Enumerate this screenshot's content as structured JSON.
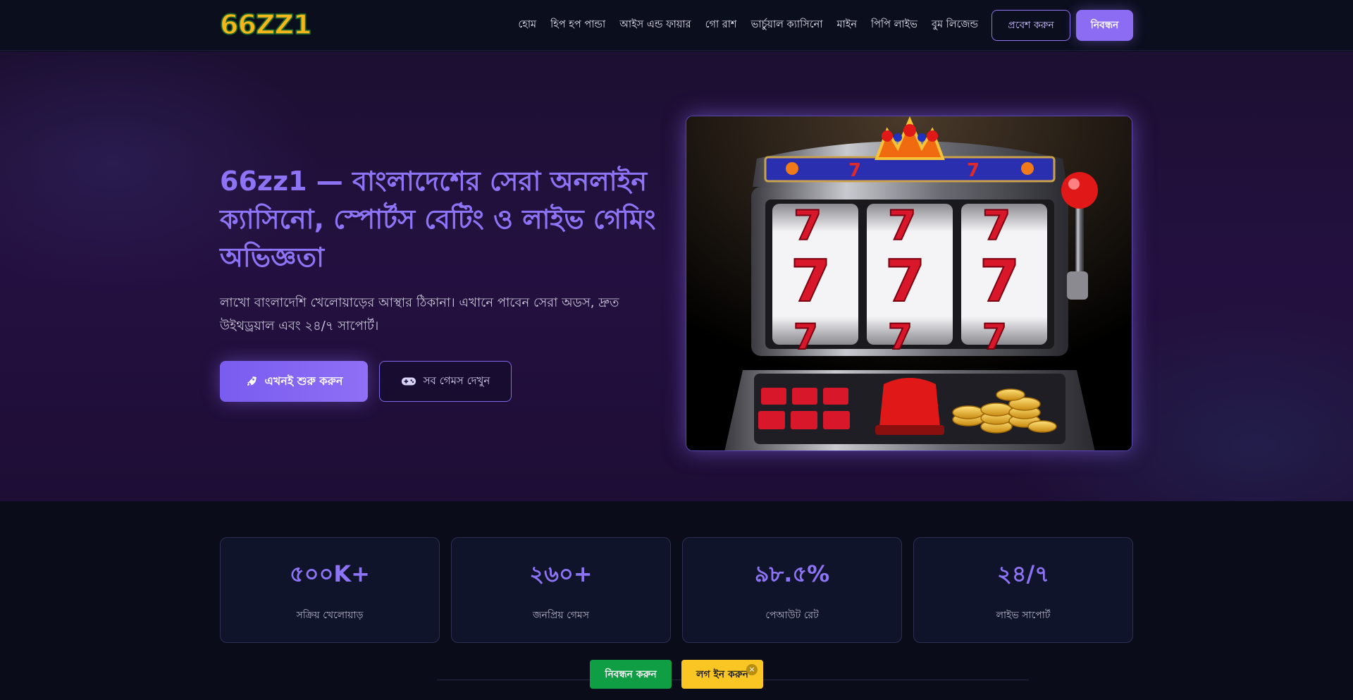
{
  "brand": {
    "logo_text": "66ZZ1"
  },
  "nav": {
    "items": [
      "হোম",
      "হিপ হপ পান্ডা",
      "আইস এন্ড ফায়ার",
      "গো রাশ",
      "ভার্চুয়াল ক্যাসিনো",
      "মাইন",
      "পিপি লাইভ",
      "বুম লিজেন্ড"
    ],
    "login_label": "প্রবেশ করুন",
    "register_label": "নিবন্ধন"
  },
  "hero": {
    "title": "66zz1 — বাংলাদেশের সেরা অনলাইন ক্যাসিনো, স্পোর্টস বেটিং ও লাইভ গেমিং অভিজ্ঞতা",
    "subtitle": "লাখো বাংলাদেশি খেলোয়াড়ের আস্থার ঠিকানা। এখানে পাবেন সেরা অডস, দ্রুত উইথড্রয়াল এবং ২৪/৭ সাপোর্ট।",
    "primary_button": "এখনই শুরু করুন",
    "primary_icon": "rocket-icon",
    "secondary_button": "সব গেমস দেখুন",
    "secondary_icon": "gamepad-icon",
    "image_name": "slot-machine-image"
  },
  "stats": [
    {
      "value": "৫০০K+",
      "label": "সক্রিয় খেলোয়াড়"
    },
    {
      "value": "২৬০+",
      "label": "জনপ্রিয় গেমস"
    },
    {
      "value": "৯৮.৫%",
      "label": "পেআউট রেট"
    },
    {
      "value": "২৪/৭",
      "label": "লাইভ সাপোর্ট"
    }
  ],
  "floating_bar": {
    "register_label": "নিবন্ধন করুন",
    "login_label": "লগ ইন করুন",
    "close_glyph": "×"
  },
  "colors": {
    "accent": "#8b6cf3",
    "register_green": "#0f9e43",
    "login_yellow": "#f9c623",
    "logo_gold": "#f6b51b"
  }
}
